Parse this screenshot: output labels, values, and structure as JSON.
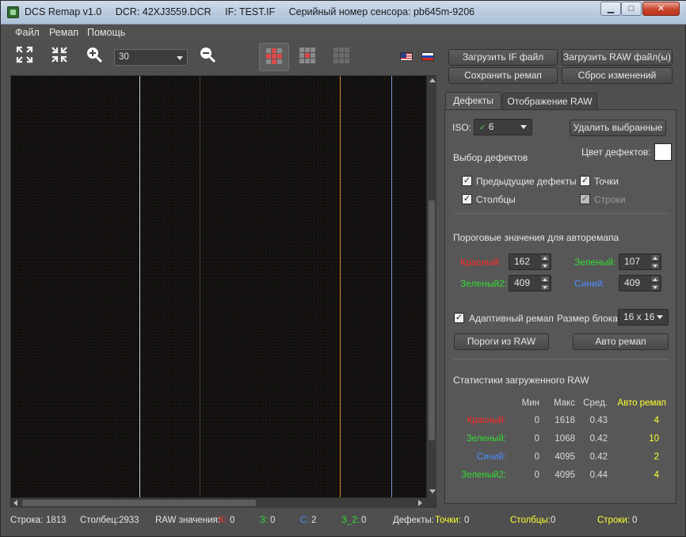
{
  "window": {
    "title_parts": [
      "DCS Remap v1.0",
      "DCR: 42XJ3559.DCR",
      "IF: TEST.IF",
      "Серийный номер сенсора: pb645m-9206"
    ],
    "minimize": "▁",
    "maximize": "□",
    "close": "✕"
  },
  "menu": [
    "Файл",
    "Ремап",
    "Помощь"
  ],
  "toolbar": {
    "zoom_value": "30",
    "icons": [
      "expand-icon",
      "collapse-icon",
      "zoom-in-icon",
      "zoom-out-icon",
      "grid-view-1-icon",
      "grid-view-2-icon",
      "grid-view-3-icon",
      "flag-us-icon",
      "flag-ru-icon"
    ]
  },
  "buttons": {
    "load_if": "Загрузить IF файл",
    "load_raw": "Загрузить RAW файл(ы)",
    "save_remap": "Сохранить ремап",
    "reset": "Сброс изменений"
  },
  "tabs": [
    "Дефекты",
    "Отображение RAW"
  ],
  "defects": {
    "iso_label": "ISO:",
    "iso_value": "6",
    "delete_selected": "Удалить выбранные",
    "select_label": "Выбор дефектов",
    "color_label": "Цвет дефектов:",
    "color": "#ffffff",
    "checks": {
      "previous": "Предыдущие дефекты",
      "points": "Точки",
      "columns": "Столбцы",
      "rows": "Строки"
    },
    "threshold_title": "Пороговые значения для авторемапа",
    "thresholds": {
      "red_label": "Красный:",
      "red_value": "162",
      "green_label": "Зеленый:",
      "green_value": "107",
      "green2_label": "Зеленый2:",
      "green2_value": "409",
      "blue_label": "Синий:",
      "blue_value": "409"
    },
    "adaptive_label": "Адаптивный ремап",
    "block_size_label": "Размер блока:",
    "block_size_value": "16 x 16",
    "thresholds_from_raw": "Пороги из RAW",
    "auto_remap": "Авто ремап",
    "stats_title": "Статистики загруженного RAW",
    "stats_headers": [
      "Мин",
      "Макс",
      "Сред.",
      "Авто ремап"
    ],
    "stats_rows": [
      {
        "name": "Красный:",
        "min": "0",
        "max": "1618",
        "avg": "0.43",
        "auto": "4"
      },
      {
        "name": "Зеленый:",
        "min": "0",
        "max": "1068",
        "avg": "0.42",
        "auto": "10"
      },
      {
        "name": "Синий:",
        "min": "0",
        "max": "4095",
        "avg": "0.42",
        "auto": "2"
      },
      {
        "name": "Зеленый2:",
        "min": "0",
        "max": "4095",
        "avg": "0.44",
        "auto": "4"
      }
    ]
  },
  "status": {
    "row_label": "Строка:",
    "row_value": "1813",
    "col_label": "Столбец:",
    "col_value": "2933",
    "raw_label": "RAW значения:",
    "k_label": "К:",
    "k_value": "0",
    "z_label": "З:",
    "z_value": "0",
    "s_label": "С:",
    "s_value": "2",
    "z2_label": "З_2:",
    "z2_value": "0",
    "defects_label": "Дефекты:",
    "points_label": "Точки:",
    "points_value": "0",
    "columns_label": "Столбцы:",
    "columns_value": "0",
    "rows_label": "Строки:",
    "rows_value": "0"
  },
  "colors": {
    "red": "#ff2a2a",
    "green": "#33dd33",
    "blue": "#4a8cff",
    "yellow": "#ffff33"
  }
}
